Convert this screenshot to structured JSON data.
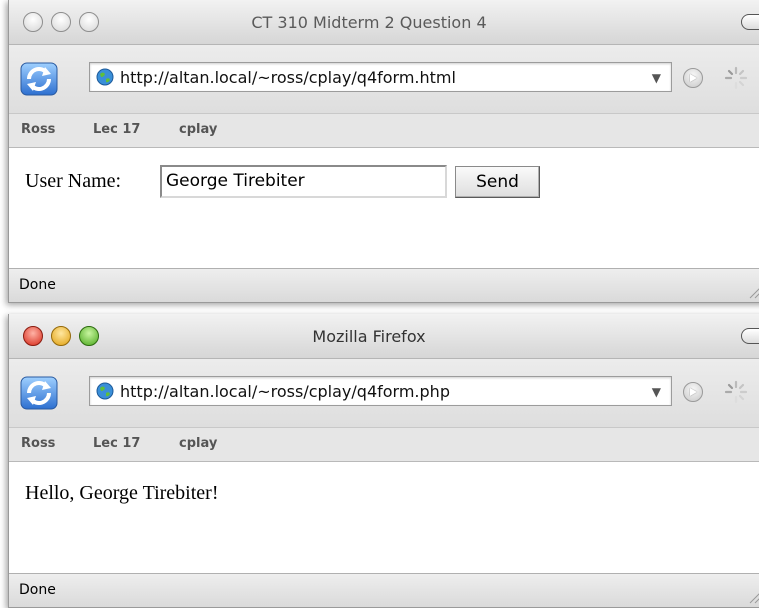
{
  "windows": [
    {
      "title": "CT 310 Midterm 2 Question 4",
      "active": false,
      "url": "http://altan.local/~ross/cplay/q4form.html",
      "bookmarks": [
        "Ross",
        "Lec 17",
        "cplay"
      ],
      "status": "Done",
      "form": {
        "label": "User Name:",
        "input_value": "George Tirebiter",
        "submit_label": "Send"
      }
    },
    {
      "title": "Mozilla Firefox",
      "active": true,
      "url": "http://altan.local/~ross/cplay/q4form.php",
      "bookmarks": [
        "Ross",
        "Lec 17",
        "cplay"
      ],
      "status": "Done",
      "greeting": "Hello, George Tirebiter!"
    }
  ],
  "colors": {
    "close": "#d62818",
    "minimize": "#e0a010",
    "zoom": "#4aa81c"
  },
  "icons": [
    "reload-icon",
    "globe-icon",
    "dropdown-arrow-icon",
    "go-icon",
    "spinner-icon",
    "resize-grip-icon"
  ]
}
